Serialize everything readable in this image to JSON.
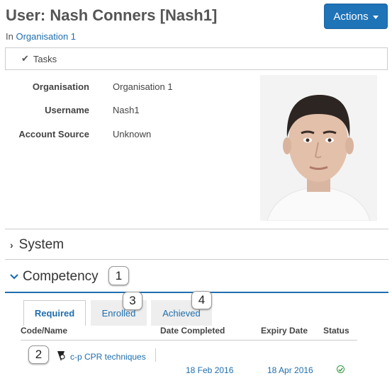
{
  "header": {
    "title": "User: Nash Conners [Nash1]",
    "actions_label": "Actions",
    "in_prefix": "In",
    "organisation_link": "Organisation 1"
  },
  "tasks_label": "Tasks",
  "details": {
    "organisation_label": "Organisation",
    "organisation_value": "Organisation 1",
    "username_label": "Username",
    "username_value": "Nash1",
    "account_source_label": "Account Source",
    "account_source_value": "Unknown"
  },
  "sections": {
    "system": "System",
    "competency": "Competency"
  },
  "tabs": {
    "required": "Required",
    "enrolled": "Enrolled",
    "achieved": "Achieved"
  },
  "table": {
    "headers": [
      "Code/Name",
      "Date Completed",
      "Expiry Date",
      "Status"
    ],
    "rows": [
      {
        "name": "c-p CPR techniques",
        "date_completed": "18 Feb 2016",
        "expiry_date": "18 Apr 2016",
        "status": "ok-circle-icon"
      }
    ]
  },
  "callouts": [
    "1",
    "2",
    "3",
    "4"
  ],
  "colors": {
    "primary": "#1f73b7",
    "link": "#1f6eae",
    "success": "#2e9a3b"
  }
}
